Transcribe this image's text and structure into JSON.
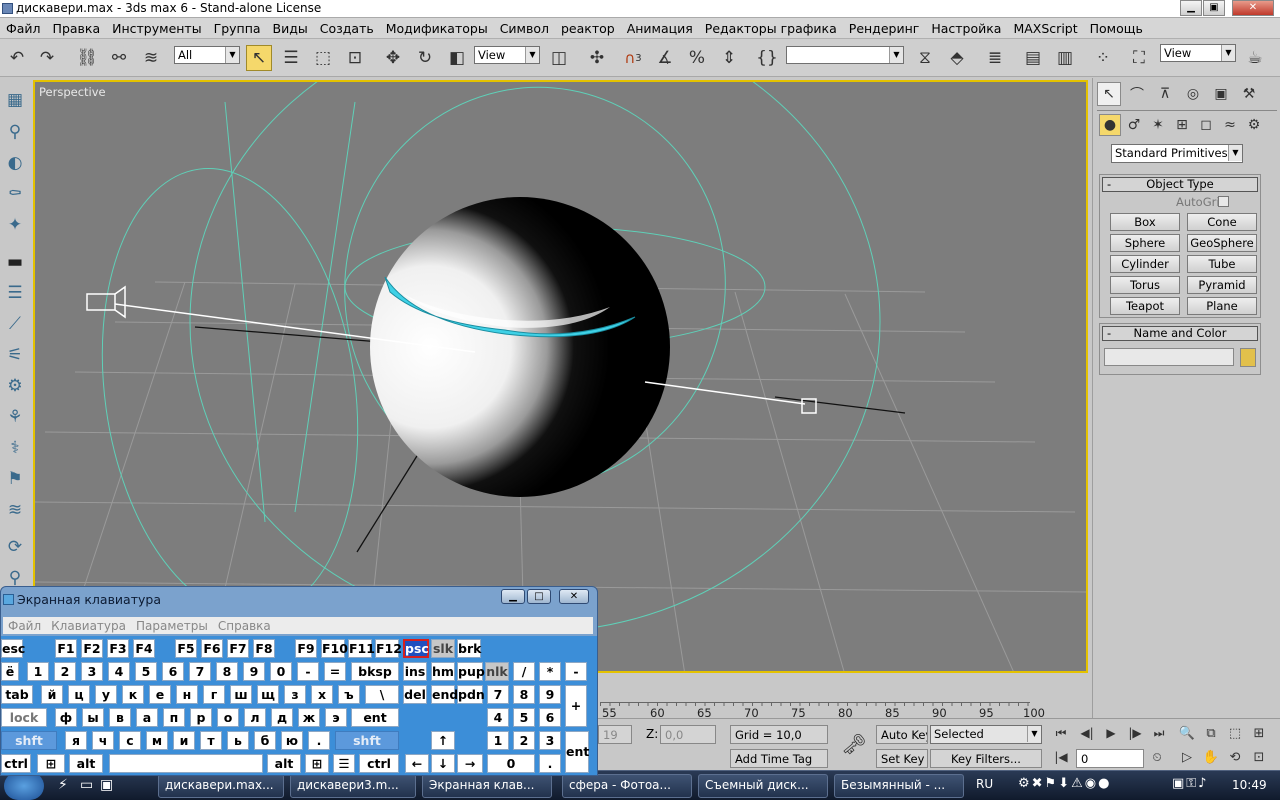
{
  "window": {
    "title": "дискавери.max - 3ds max 6 - Stand-alone License",
    "minimize": "▁",
    "maximize": "▣",
    "close": "✕"
  },
  "menu": [
    "Файл",
    "Правка",
    "Инструменты",
    "Группа",
    "Виды",
    "Создать",
    "Модификаторы",
    "Символ",
    "реактор",
    "Анимация",
    "Редакторы графика",
    "Рендеринг",
    "Настройка",
    "MAXScript",
    "Помощь"
  ],
  "toolbar": {
    "selection_filter": "All",
    "ref_coord": "View",
    "named_sel": "",
    "render_view": "View",
    "snap_angle": "3",
    "snap_percent": "%"
  },
  "viewport": {
    "label": "Perspective"
  },
  "command_panel": {
    "category": "Standard Primitives",
    "object_type": {
      "title": "Object Type",
      "autogrid": "AutoGrid",
      "buttons": [
        "Box",
        "Cone",
        "Sphere",
        "GeoSphere",
        "Cylinder",
        "Tube",
        "Torus",
        "Pyramid",
        "Teapot",
        "Plane"
      ]
    },
    "name_color": {
      "title": "Name and Color",
      "name_value": "",
      "color": "#e2c04b"
    },
    "collapse": "-"
  },
  "timeline": {
    "ticks": [
      "55",
      "60",
      "65",
      "70",
      "75",
      "80",
      "85",
      "90",
      "95",
      "100"
    ]
  },
  "status": {
    "y_value": "19",
    "z_label": "Z:",
    "z_value": "0,0",
    "grid": "Grid = 10,0",
    "add_time_tag": "Add Time Tag",
    "auto_key": "Auto Key",
    "set_key": "Set Key",
    "key_mode": "Selected",
    "key_filters": "Key Filters...",
    "frame": "0"
  },
  "osk": {
    "title": "Экранная клавиатура",
    "menu": [
      "Файл",
      "Клавиатура",
      "Параметры",
      "Справка"
    ],
    "row1": [
      "esc",
      "F1",
      "F2",
      "F3",
      "F4",
      "F5",
      "F6",
      "F7",
      "F8",
      "F9",
      "F10",
      "F11",
      "F12",
      "psc",
      "slk",
      "brk"
    ],
    "row2": [
      "ё",
      "1",
      "2",
      "3",
      "4",
      "5",
      "6",
      "7",
      "8",
      "9",
      "0",
      "-",
      "=",
      "bksp",
      "ins",
      "hm",
      "pup",
      "nlk",
      "/",
      "*",
      "-"
    ],
    "row3": [
      "tab",
      "й",
      "ц",
      "у",
      "к",
      "е",
      "н",
      "г",
      "ш",
      "щ",
      "з",
      "х",
      "ъ",
      "\\",
      "del",
      "end",
      "pdn",
      "7",
      "8",
      "9",
      "+"
    ],
    "row4": [
      "lock",
      "ф",
      "ы",
      "в",
      "а",
      "п",
      "р",
      "о",
      "л",
      "д",
      "ж",
      "э",
      "ent",
      "4",
      "5",
      "6"
    ],
    "row5": [
      "shft",
      "я",
      "ч",
      "с",
      "м",
      "и",
      "т",
      "ь",
      "б",
      "ю",
      ".",
      "shft",
      "↑",
      "1",
      "2",
      "3",
      "ent"
    ],
    "row6": [
      "ctrl",
      "alt",
      "alt",
      "ctrl",
      "←",
      "↓",
      "→",
      "0",
      "."
    ]
  },
  "taskbar": {
    "tasks": [
      "дискавери.max...",
      "дискавери3.m...",
      "Экранная клав...",
      "сфера - Фотоа...",
      "Съемный диск...",
      "Безымянный - ..."
    ],
    "lang": "RU",
    "clock": "10:49"
  }
}
